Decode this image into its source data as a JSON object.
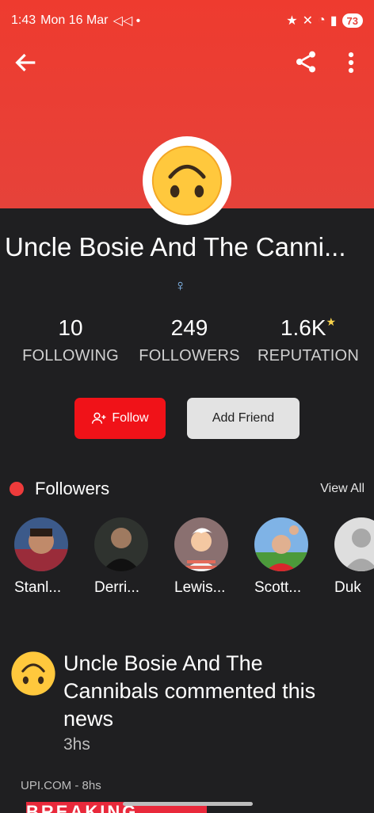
{
  "status": {
    "time": "1:43",
    "date": "Mon 16 Mar",
    "battery": "73"
  },
  "profile": {
    "name": "Uncle Bosie And The Canni...",
    "gender_symbol": "♀",
    "following_count": "10",
    "following_label": "FOLLOWING",
    "followers_count": "249",
    "followers_label": "FOLLOWERS",
    "reputation_count": "1.6K",
    "reputation_label": "REPUTATION"
  },
  "actions": {
    "follow": "Follow",
    "add_friend": "Add Friend"
  },
  "followers_section": {
    "title": "Followers",
    "view_all": "View All",
    "items": [
      {
        "name": "Stanl..."
      },
      {
        "name": "Derri..."
      },
      {
        "name": "Lewis..."
      },
      {
        "name": "Scott..."
      },
      {
        "name": "Duk"
      }
    ]
  },
  "activity": {
    "text": "Uncle Bosie And The Cannibals commented this news",
    "time": "3hs",
    "source": "UPI.COM",
    "source_time": "8hs",
    "source_sep": "-",
    "banner": "BREAKING NEWS"
  },
  "colors": {
    "header": "#ee3b2f",
    "follow": "#f01218",
    "background": "#1f1f21"
  }
}
